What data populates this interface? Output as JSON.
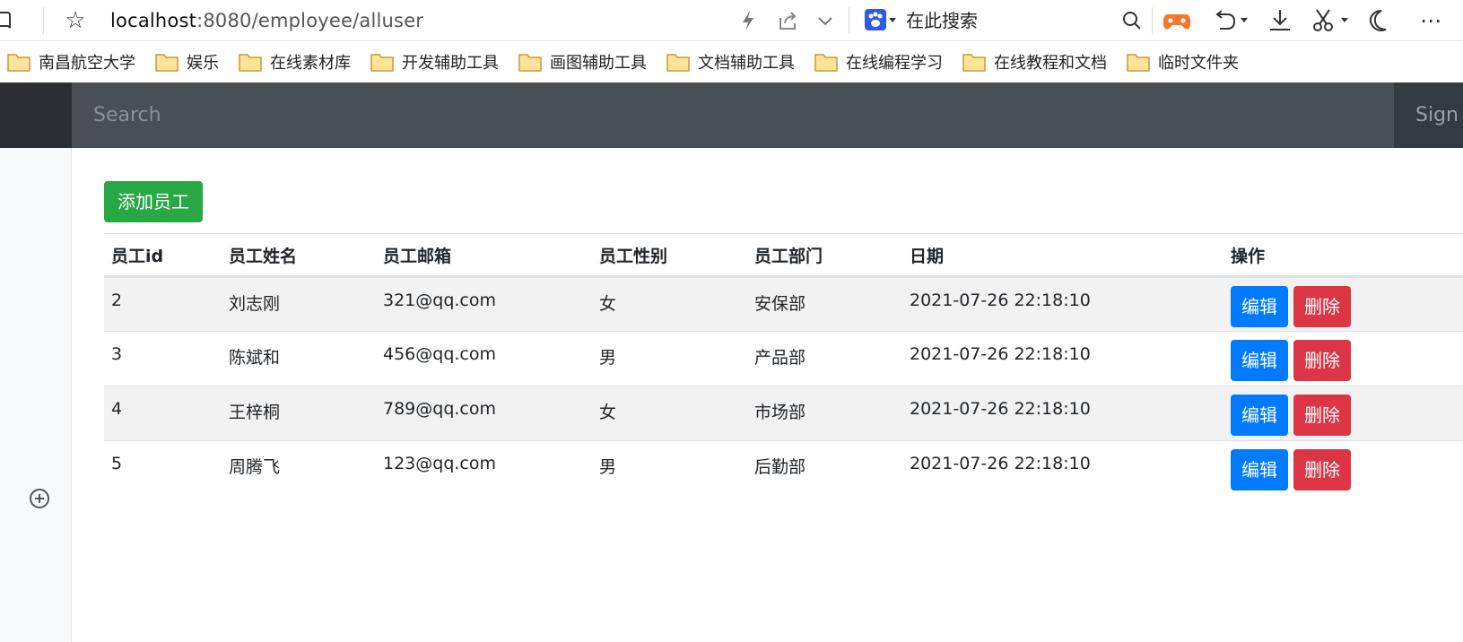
{
  "browser": {
    "url_host": "localhost",
    "url_path": ":8080/employee/alluser",
    "search_engine_placeholder": "在此搜索",
    "icons": [
      "reader-icon",
      "star-icon",
      "bolt-icon",
      "share-icon",
      "chevron-down-icon",
      "paw-icon",
      "search-icon",
      "gamepad-icon",
      "undo-icon",
      "download-icon",
      "scissors-icon",
      "moon-icon",
      "more-icon"
    ]
  },
  "bookmarks": [
    {
      "label": "南昌航空大学"
    },
    {
      "label": "娱乐"
    },
    {
      "label": "在线素材库"
    },
    {
      "label": "开发辅助工具"
    },
    {
      "label": "画图辅助工具"
    },
    {
      "label": "文档辅助工具"
    },
    {
      "label": "在线编程学习"
    },
    {
      "label": "在线教程和文档"
    },
    {
      "label": "临时文件夹"
    }
  ],
  "navbar": {
    "search_placeholder": "Search",
    "sign_out": "Sign out"
  },
  "main": {
    "add_button": "添加员工",
    "table": {
      "headers": [
        "员工id",
        "员工姓名",
        "员工邮箱",
        "员工性别",
        "员工部门",
        "日期",
        "操作"
      ],
      "rows": [
        {
          "id": "2",
          "name": "刘志刚",
          "email": "321@qq.com",
          "gender": "女",
          "dept": "安保部",
          "date": "2021-07-26 22:18:10"
        },
        {
          "id": "3",
          "name": "陈斌和",
          "email": "456@qq.com",
          "gender": "男",
          "dept": "产品部",
          "date": "2021-07-26 22:18:10"
        },
        {
          "id": "4",
          "name": "王梓桐",
          "email": "789@qq.com",
          "gender": "女",
          "dept": "市场部",
          "date": "2021-07-26 22:18:10"
        },
        {
          "id": "5",
          "name": "周腾飞",
          "email": "123@qq.com",
          "gender": "男",
          "dept": "后勤部",
          "date": "2021-07-26 22:18:10"
        }
      ],
      "edit_label": "编辑",
      "delete_label": "删除"
    }
  },
  "colors": {
    "navbar_bg": "#343a40",
    "search_bg": "#4a4e55",
    "add_button": "#28a745",
    "edit_button": "#007bff",
    "delete_button": "#dc3545",
    "stripe": "#f2f2f2"
  }
}
